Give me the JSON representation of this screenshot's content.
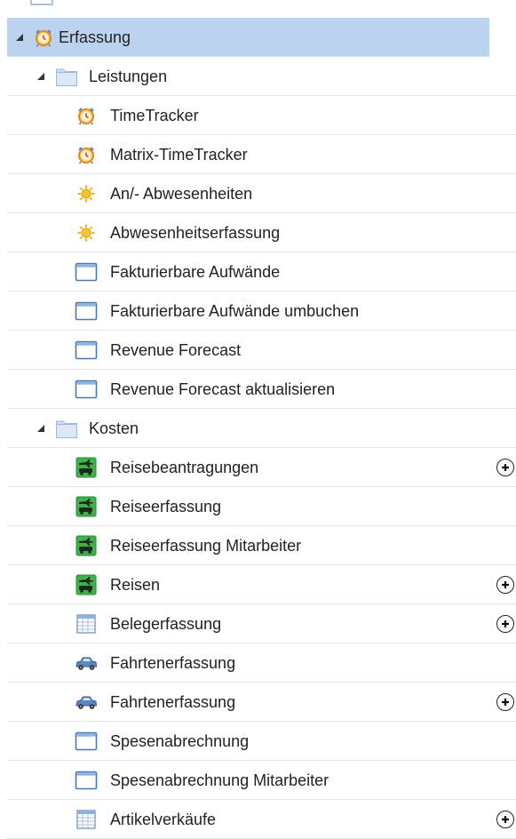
{
  "tree": {
    "root": {
      "label": "Erfassung",
      "icon": "alarm-clock-icon",
      "expanded": true,
      "selected": true,
      "groups": [
        {
          "label": "Leistungen",
          "icon": "folder-icon",
          "expanded": true,
          "items": [
            {
              "label": "TimeTracker",
              "icon": "alarm-clock-icon",
              "add": false
            },
            {
              "label": "Matrix-TimeTracker",
              "icon": "alarm-clock-icon",
              "add": false
            },
            {
              "label": "An/- Abwesenheiten",
              "icon": "sun-icon",
              "add": false
            },
            {
              "label": "Abwesenheitserfassung",
              "icon": "sun-icon",
              "add": false
            },
            {
              "label": "Fakturierbare Aufwände",
              "icon": "window-icon",
              "add": false
            },
            {
              "label": "Fakturierbare Aufwände umbuchen",
              "icon": "window-icon",
              "add": false
            },
            {
              "label": "Revenue Forecast",
              "icon": "window-icon",
              "add": false
            },
            {
              "label": "Revenue Forecast aktualisieren",
              "icon": "window-icon",
              "add": false
            }
          ]
        },
        {
          "label": "Kosten",
          "icon": "folder-icon",
          "expanded": true,
          "items": [
            {
              "label": "Reisebeantragungen",
              "icon": "travel-icon",
              "add": true
            },
            {
              "label": "Reiseerfassung",
              "icon": "travel-icon",
              "add": false
            },
            {
              "label": "Reiseerfassung Mitarbeiter",
              "icon": "travel-icon",
              "add": false
            },
            {
              "label": "Reisen",
              "icon": "travel-icon",
              "add": true
            },
            {
              "label": "Belegerfassung",
              "icon": "spreadsheet-icon",
              "add": true
            },
            {
              "label": "Fahrtenerfassung",
              "icon": "car-icon",
              "add": false
            },
            {
              "label": "Fahrtenerfassung",
              "icon": "car-icon",
              "add": true
            },
            {
              "label": "Spesenabrechnung",
              "icon": "window-icon",
              "add": false
            },
            {
              "label": "Spesenabrechnung Mitarbeiter",
              "icon": "window-icon",
              "add": false
            },
            {
              "label": "Artikelverkäufe",
              "icon": "spreadsheet-icon",
              "add": true
            }
          ]
        }
      ]
    }
  },
  "colors": {
    "selection": "#bcd3f0",
    "divider": "#e4e4e4",
    "travel_green": "#3fb14a",
    "window_blue": "#4a78b5",
    "car_blue": "#4e79b4",
    "sun_orange": "#f0a020",
    "folder_blue": "#bcd9f2"
  }
}
